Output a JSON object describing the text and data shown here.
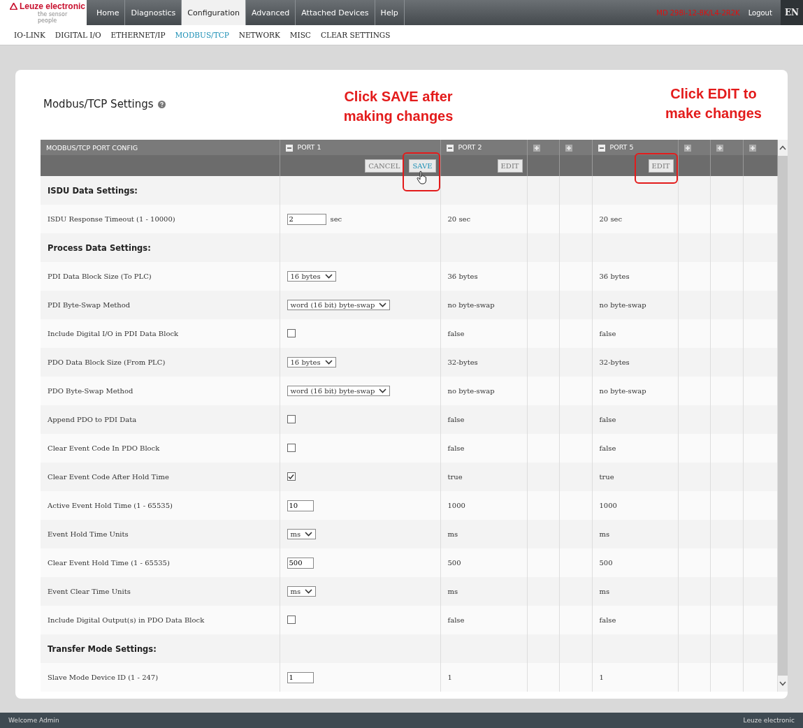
{
  "header": {
    "logo": {
      "brand": "Leuze electronic",
      "tagline": "the sensor people"
    },
    "tabs": [
      {
        "label": "Home",
        "selected": false
      },
      {
        "label": "Diagnostics",
        "selected": false
      },
      {
        "label": "Configuration",
        "selected": true
      },
      {
        "label": "Advanced",
        "selected": false
      },
      {
        "label": "Attached Devices",
        "selected": false
      },
      {
        "label": "Help",
        "selected": false
      }
    ],
    "device_model": "MD 298i-12-8K/L4-2R2K",
    "logout": "Logout",
    "language": "EN"
  },
  "subnav": [
    {
      "label": "IO-LINK",
      "selected": false
    },
    {
      "label": "DIGITAL I/O",
      "selected": false
    },
    {
      "label": "ETHERNET/IP",
      "selected": false
    },
    {
      "label": "MODBUS/TCP",
      "selected": true
    },
    {
      "label": "NETWORK",
      "selected": false
    },
    {
      "label": "MISC",
      "selected": false
    },
    {
      "label": "CLEAR SETTINGS",
      "selected": false
    }
  ],
  "page": {
    "title": "Modbus/TCP Settings",
    "annotations": [
      {
        "text": "Click SAVE after making changes"
      },
      {
        "text": "Click EDIT to make changes"
      }
    ]
  },
  "table": {
    "columns": [
      {
        "kind": "label",
        "label": "MODBUS/TCP PORT CONFIG"
      },
      {
        "kind": "port",
        "label": "PORT 1",
        "expanded": true,
        "buttons": [
          {
            "kind": "cancel",
            "label": "CANCEL"
          },
          {
            "kind": "save",
            "label": "SAVE"
          }
        ]
      },
      {
        "kind": "port",
        "label": "PORT 2",
        "expanded": true,
        "buttons": [
          {
            "kind": "edit",
            "label": "EDIT"
          }
        ]
      },
      {
        "kind": "port",
        "expanded": false
      },
      {
        "kind": "port",
        "expanded": false
      },
      {
        "kind": "port",
        "label": "PORT 5",
        "expanded": true,
        "buttons": [
          {
            "kind": "edit",
            "label": "EDIT"
          }
        ]
      },
      {
        "kind": "port",
        "expanded": false
      },
      {
        "kind": "port",
        "expanded": false
      },
      {
        "kind": "port",
        "expanded": false
      }
    ],
    "rows": [
      {
        "kind": "section",
        "label": "ISDU Data Settings:"
      },
      {
        "kind": "setting",
        "label": "ISDU Response Timeout (1 - 10000)",
        "cells": [
          {
            "kind": "input",
            "value": "2",
            "suffix": "sec"
          },
          "20 sec",
          "20 sec"
        ]
      },
      {
        "kind": "section",
        "label": "Process Data Settings:"
      },
      {
        "kind": "setting",
        "label": "PDI Data Block Size (To PLC)",
        "cells": [
          {
            "kind": "select",
            "value": "16 bytes"
          },
          "36 bytes",
          "36 bytes"
        ]
      },
      {
        "kind": "setting",
        "label": "PDI Byte-Swap Method",
        "cells": [
          {
            "kind": "select",
            "value": "word (16 bit) byte-swap"
          },
          "no byte-swap",
          "no byte-swap"
        ]
      },
      {
        "kind": "setting",
        "label": "Include Digital I/O in PDI Data Block",
        "cells": [
          {
            "kind": "checkbox",
            "checked": false
          },
          "false",
          "false"
        ]
      },
      {
        "kind": "setting",
        "label": "PDO Data Block Size (From PLC)",
        "cells": [
          {
            "kind": "select",
            "value": "16 bytes"
          },
          "32-bytes",
          "32-bytes"
        ]
      },
      {
        "kind": "setting",
        "label": "PDO Byte-Swap Method",
        "cells": [
          {
            "kind": "select",
            "value": "word (16 bit) byte-swap"
          },
          "no byte-swap",
          "no byte-swap"
        ]
      },
      {
        "kind": "setting",
        "label": "Append PDO to PDI Data",
        "cells": [
          {
            "kind": "checkbox",
            "checked": false
          },
          "false",
          "false"
        ]
      },
      {
        "kind": "setting",
        "label": "Clear Event Code In PDO Block",
        "cells": [
          {
            "kind": "checkbox",
            "checked": false
          },
          "false",
          "false"
        ]
      },
      {
        "kind": "setting",
        "label": "Clear Event Code After Hold Time",
        "cells": [
          {
            "kind": "checkbox",
            "checked": true
          },
          "true",
          "true"
        ]
      },
      {
        "kind": "setting",
        "label": "Active Event Hold Time (1 - 65535)",
        "cells": [
          {
            "kind": "input",
            "value": "10"
          },
          "1000",
          "1000"
        ]
      },
      {
        "kind": "setting",
        "label": "Event Hold Time Units",
        "cells": [
          {
            "kind": "select",
            "value": "ms"
          },
          "ms",
          "ms"
        ]
      },
      {
        "kind": "setting",
        "label": "Clear Event Hold Time (1 - 65535)",
        "cells": [
          {
            "kind": "input",
            "value": "500"
          },
          "500",
          "500"
        ]
      },
      {
        "kind": "setting",
        "label": "Event Clear Time Units",
        "cells": [
          {
            "kind": "select",
            "value": "ms"
          },
          "ms",
          "ms"
        ]
      },
      {
        "kind": "setting",
        "label": "Include Digital Output(s) in PDO Data Block",
        "cells": [
          {
            "kind": "checkbox",
            "checked": false
          },
          "false",
          "false"
        ]
      },
      {
        "kind": "section",
        "label": "Transfer Mode Settings:"
      },
      {
        "kind": "setting",
        "label": "Slave Mode Device ID (1 - 247)",
        "cells": [
          {
            "kind": "input",
            "value": "1"
          },
          "1",
          "1"
        ]
      }
    ]
  },
  "footer": {
    "welcome": "Welcome Admin",
    "brand": "Leuze electronic"
  }
}
